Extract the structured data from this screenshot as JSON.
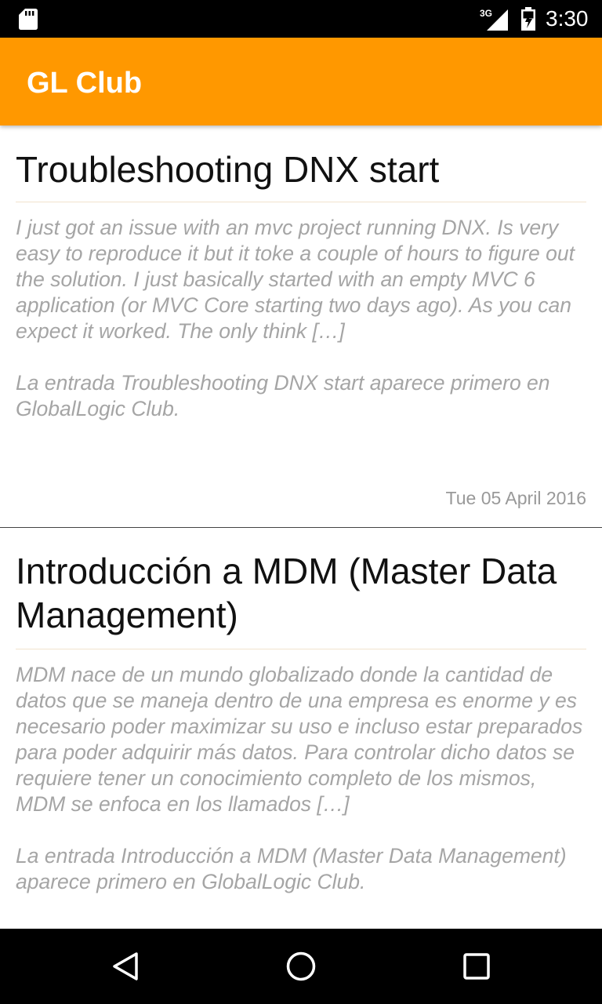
{
  "status_bar": {
    "time": "3:30",
    "network": "3G",
    "icons": [
      "sd-card-icon",
      "cell-signal-icon",
      "battery-icon"
    ]
  },
  "app_bar": {
    "title": "GL Club",
    "color": "#ff9800"
  },
  "posts": [
    {
      "title": "Troubleshooting DNX start",
      "excerpt": "I just got an issue with an mvc project running DNX. Is very easy to reproduce it but it toke a couple of hours to figure out the solution. I just basically started with an empty MVC 6 application (or MVC Core starting two days ago). As you can expect it worked. The only think […]",
      "footer": "La entrada Troubleshooting DNX start aparece primero en GlobalLogic Club.",
      "date": "Tue 05 April 2016"
    },
    {
      "title": "Introducción a MDM (Master Data Management)",
      "excerpt": "MDM nace de un mundo globalizado donde la cantidad de datos que se maneja dentro de una empresa es enorme y es necesario poder maximizar su uso e incluso estar preparados para poder adquirir más datos. Para controlar dicho datos se requiere tener un conocimiento completo de los mismos, MDM se enfoca en los llamados […]",
      "footer": "La entrada Introducción a MDM (Master Data Management) aparece primero en GlobalLogic Club."
    }
  ],
  "nav_bar": {
    "buttons": [
      "back-icon",
      "home-icon",
      "recents-icon"
    ]
  }
}
